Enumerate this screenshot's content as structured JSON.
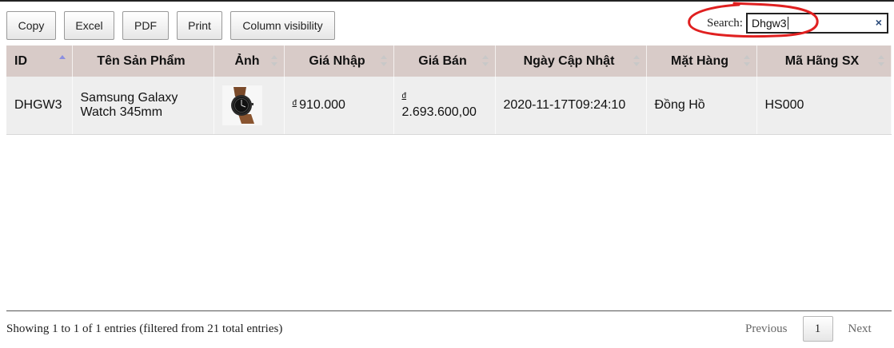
{
  "toolbar": {
    "buttons": [
      "Copy",
      "Excel",
      "PDF",
      "Print",
      "Column visibility"
    ]
  },
  "search": {
    "label": "Search:",
    "value": "Dhgw3",
    "clear_icon": "×"
  },
  "table": {
    "columns": [
      "ID",
      "Tên Sản Phẩm",
      "Ảnh",
      "Giá Nhập",
      "Giá Bán",
      "Ngày Cập Nhật",
      "Mặt Hàng",
      "Mã Hãng SX"
    ],
    "sorted_column": "ID",
    "rows": [
      {
        "id": "DHGW3",
        "name": "Samsung Galaxy Watch 345mm",
        "image_icon": "smartwatch-image",
        "import_currency": "đ",
        "import_price": "910.000",
        "sale_currency": "đ",
        "sale_price": "2.693.600,00",
        "updated": "2020-11-17T09:24:10",
        "category": "Đồng Hồ",
        "brand": "HS000"
      }
    ]
  },
  "footer": {
    "info": "Showing 1 to 1 of 1 entries (filtered from 21 total entries)",
    "previous": "Previous",
    "page": "1",
    "next": "Next"
  },
  "colors": {
    "header_bg": "#d8cbc8",
    "row_bg": "#eeeeee",
    "annotation": "#e02020",
    "sort_active": "#8b8fe0"
  }
}
